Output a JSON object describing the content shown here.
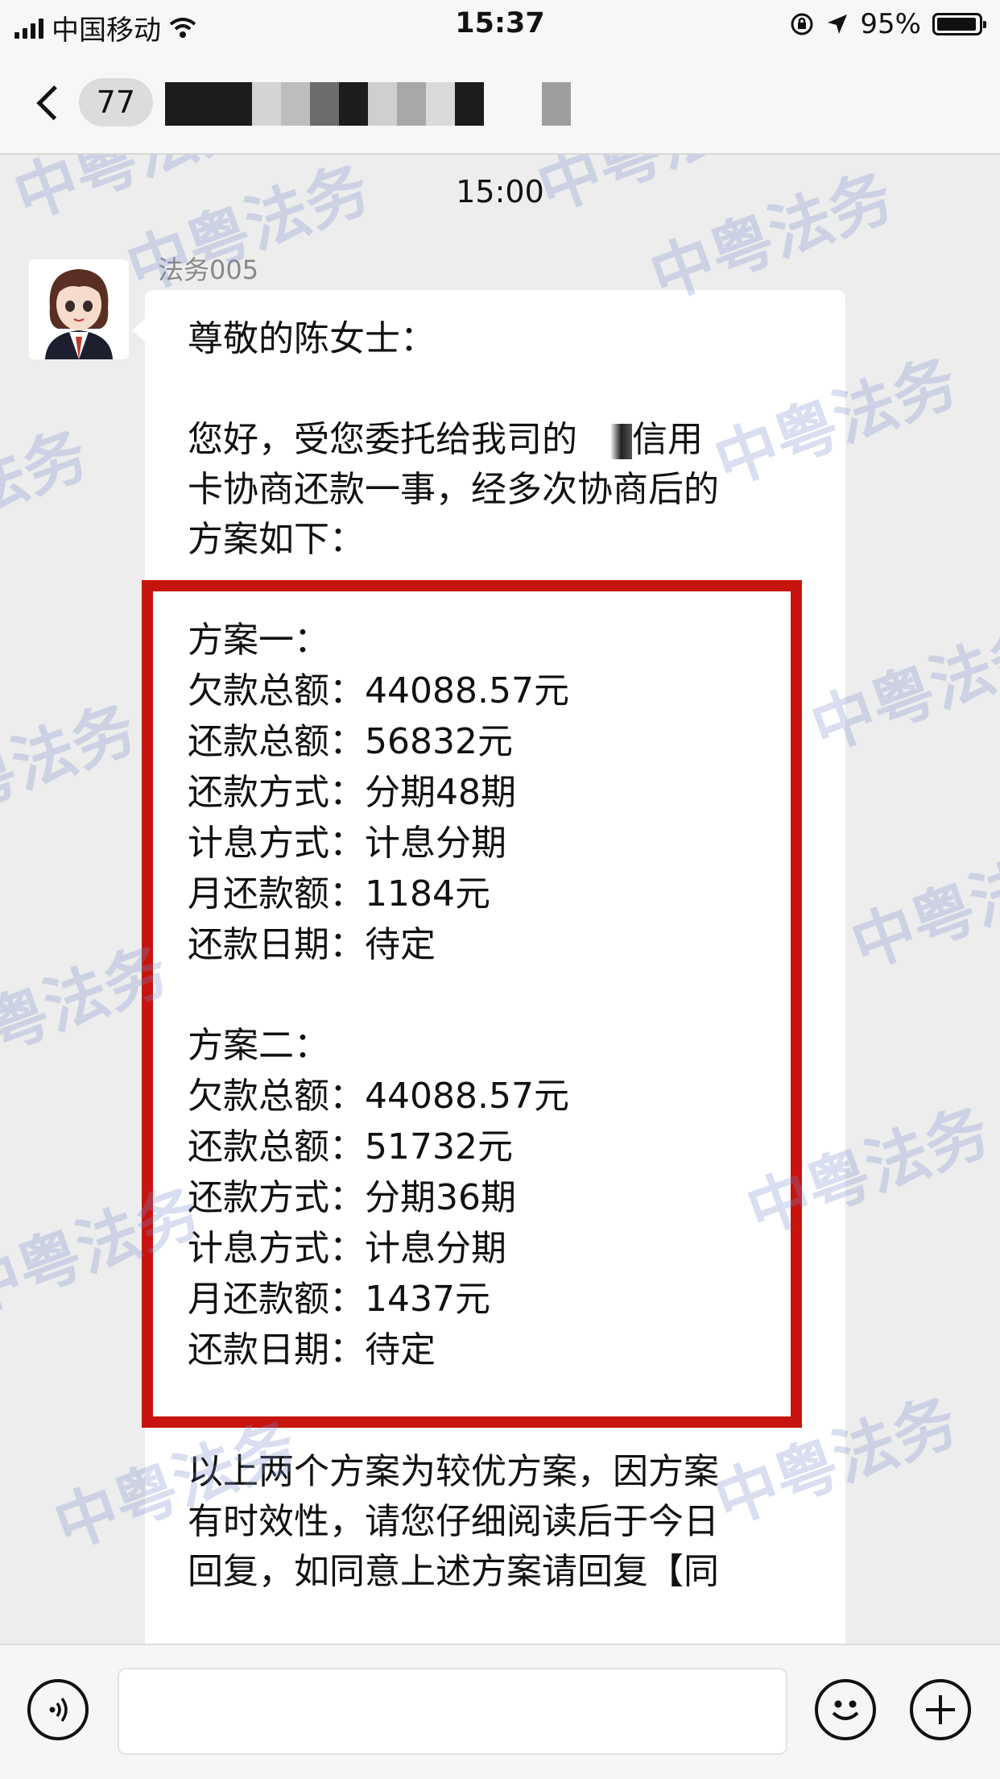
{
  "status_bar": {
    "carrier": "中国移动",
    "time": "15:37",
    "battery_percent": "95%",
    "battery_level": 0.95
  },
  "nav": {
    "unread_count": "77"
  },
  "chat": {
    "timestamp": "15:00",
    "sender_name": "法务005",
    "message": {
      "greeting": "尊敬的陈女士：",
      "intro_line1": "您好，受您委托给我司的",
      "intro_line1_end": "信用",
      "intro_line2": "卡协商还款一事，经多次协商后的",
      "intro_line3": "方案如下：",
      "plans": [
        {
          "title": "方案一：",
          "rows": [
            {
              "label": "欠款总额：",
              "value": "44088.57元"
            },
            {
              "label": "还款总额：",
              "value": "56832元"
            },
            {
              "label": "还款方式：",
              "value": "分期48期"
            },
            {
              "label": "计息方式：",
              "value": "计息分期"
            },
            {
              "label": "月还款额：",
              "value": "1184元"
            },
            {
              "label": "还款日期：",
              "value": "待定"
            }
          ]
        },
        {
          "title": "方案二：",
          "rows": [
            {
              "label": "欠款总额：",
              "value": "44088.57元"
            },
            {
              "label": "还款总额：",
              "value": "51732元"
            },
            {
              "label": "还款方式：",
              "value": "分期36期"
            },
            {
              "label": "计息方式：",
              "value": "计息分期"
            },
            {
              "label": "月还款额：",
              "value": "1437元"
            },
            {
              "label": "还款日期：",
              "value": "待定"
            }
          ]
        }
      ],
      "closing_line1": "以上两个方案为较优方案，因方案",
      "closing_line2": "有时效性，请您仔细阅读后于今日",
      "closing_line3": "回复，如同意上述方案请回复【同"
    }
  },
  "watermark_text": "中粤法务",
  "colors": {
    "highlight_frame": "#c8140f",
    "bubble": "#ffffff",
    "background": "#ededed"
  },
  "icons": {
    "voice": "voice-icon",
    "emoji": "emoji-icon",
    "plus": "plus-icon"
  }
}
